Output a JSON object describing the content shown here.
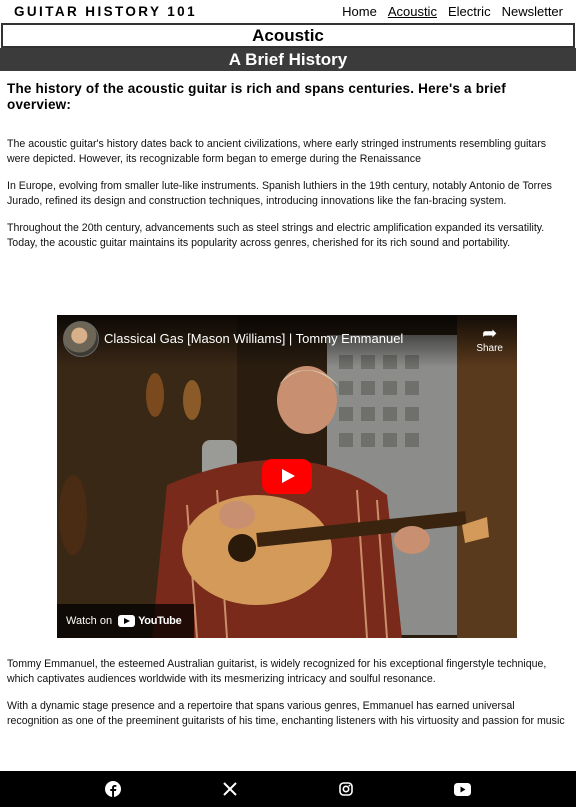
{
  "nav": {
    "brand": "GUITAR HISTORY 101",
    "links": [
      "Home",
      "Acoustic",
      "Electric",
      "Newsletter"
    ],
    "active": "Acoustic"
  },
  "page": {
    "title": "Acoustic",
    "subtitle": "A Brief History"
  },
  "intro": "The history of the acoustic guitar is rich and spans centuries. Here's a brief overview:",
  "paragraphs": [
    "The acoustic guitar's history dates back to ancient civilizations, where early stringed instruments resembling guitars were depicted. However, its recognizable form began to emerge during the Renaissance",
    "In Europe, evolving from smaller lute-like instruments. Spanish luthiers in the 19th century, notably Antonio de Torres Jurado, refined its design and construction techniques, introducing innovations like the fan-bracing system.",
    "Throughout the 20th century, advancements such as steel strings and electric amplification expanded its versatility. Today, the acoustic guitar maintains its popularity across genres, cherished for its rich sound and portability."
  ],
  "video": {
    "title": "Classical Gas [Mason Williams] | Tommy Emmanuel",
    "share_label": "Share",
    "watch_label": "Watch on",
    "platform": "YouTube"
  },
  "after_paragraphs": [
    "Tommy Emmanuel, the esteemed Australian guitarist, is widely recognized for his exceptional fingerstyle technique, which captivates audiences worldwide with its mesmerizing intricacy and soulful resonance.",
    "With a dynamic stage presence and a repertoire that spans various genres, Emmanuel has earned universal recognition as one of the preeminent guitarists of his time, enchanting listeners with his virtuosity and passion for music"
  ],
  "footer": {
    "icons": [
      "facebook-icon",
      "x-icon",
      "instagram-icon",
      "youtube-icon"
    ]
  },
  "colors": {
    "header_bar": "#3b3b3b",
    "footer": "#000000",
    "play_button": "#ff0000"
  }
}
